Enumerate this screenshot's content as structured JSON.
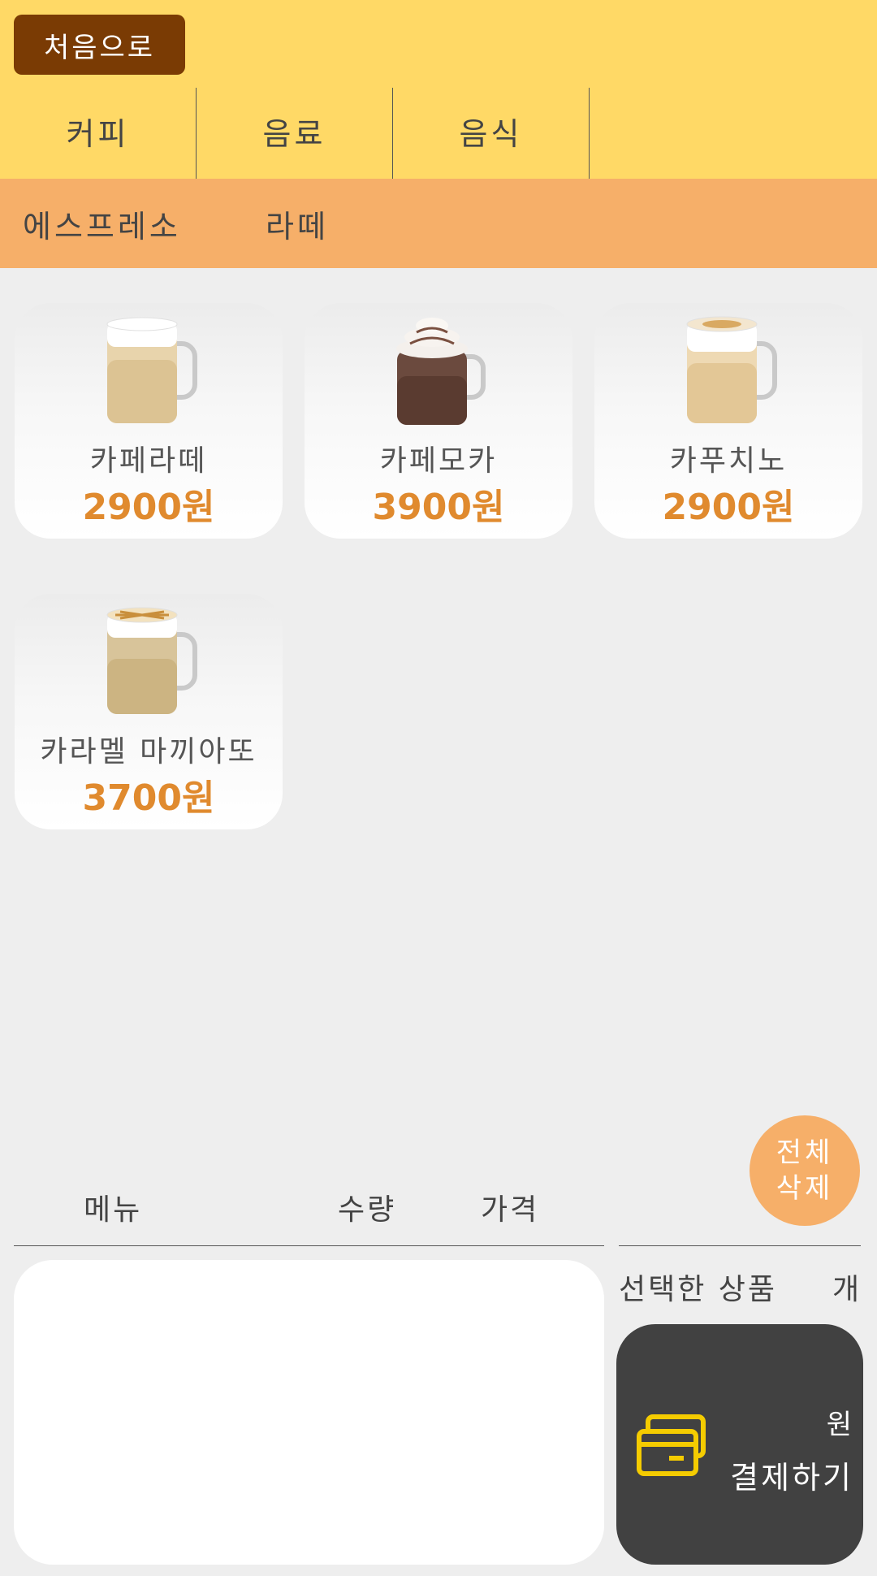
{
  "header": {
    "home_label": "처음으로",
    "categories": [
      {
        "label": "커피"
      },
      {
        "label": "음료"
      },
      {
        "label": "음식"
      }
    ]
  },
  "subcategories": [
    {
      "label": "에스프레소"
    },
    {
      "label": "라떼"
    }
  ],
  "products": [
    {
      "name": "카페라떼",
      "price": "2900원",
      "icon": "latte-mug-icon"
    },
    {
      "name": "카페모카",
      "price": "3900원",
      "icon": "mocha-mug-icon"
    },
    {
      "name": "카푸치노",
      "price": "2900원",
      "icon": "cappuccino-mug-icon"
    },
    {
      "name": "카라멜 마끼아또",
      "price": "3700원",
      "icon": "caramel-macchiato-mug-icon"
    }
  ],
  "cart": {
    "clear_label_line1": "전체",
    "clear_label_line2": "삭제",
    "col_menu": "메뉴",
    "col_qty": "수량",
    "col_price": "가격",
    "items": []
  },
  "summary": {
    "selected_label": "선택한 상품",
    "count_unit": "개",
    "total_unit": "원",
    "pay_label": "결제하기"
  },
  "colors": {
    "top_bar": "#ffd966",
    "sub_bar": "#f6af69",
    "home_button": "#7a3b04",
    "price": "#e08a2e",
    "pay_button": "#414141",
    "card_icon": "#f5cc00"
  }
}
